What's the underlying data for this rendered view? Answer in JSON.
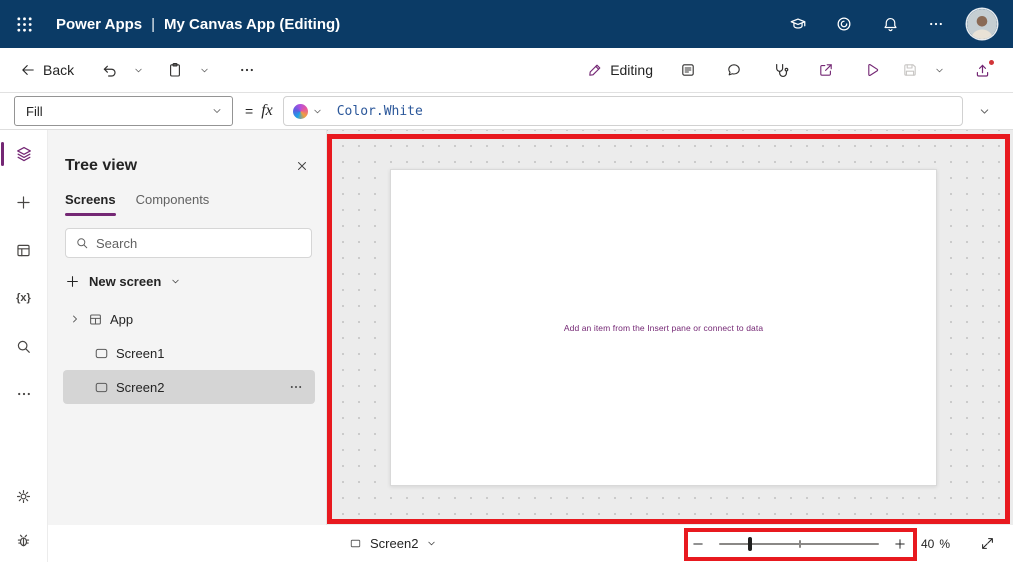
{
  "colors": {
    "header_bg": "#0b3b66",
    "accent_purple": "#742774",
    "annotation_red": "#e8191f",
    "formula_text_blue": "#2b579a",
    "canvas_hint_purple": "#742774"
  },
  "header": {
    "product": "Power Apps",
    "separator": "|",
    "app_title": "My Canvas App (Editing)",
    "icons": [
      "app-launcher-icon",
      "environment-icon",
      "copilot-icon",
      "notifications-icon",
      "more-icon",
      "avatar"
    ]
  },
  "command_bar": {
    "back_label": "Back",
    "editing_label": "Editing",
    "icons": [
      "back-icon",
      "undo-icon",
      "undo-chevron",
      "paste-icon",
      "paste-chevron",
      "more-icon",
      "pencil-icon",
      "app-checklist-icon",
      "comments-icon",
      "app-checker-icon",
      "share-icon",
      "preview-play-icon",
      "save-icon",
      "save-chevron",
      "publish-icon"
    ]
  },
  "formula_bar": {
    "property_selected": "Fill",
    "equals_sign": "=",
    "fx_label": "fx",
    "formula": "Color.White",
    "icons": [
      "chevron-down-icon",
      "copilot-icon",
      "expand-chevron-icon"
    ]
  },
  "left_rail": {
    "variables_glyph": "{x}",
    "icons": [
      "tree-view-icon",
      "insert-icon",
      "data-icon",
      "variables-icon",
      "search-icon",
      "more-icon",
      "settings-icon",
      "bug-icon"
    ]
  },
  "tree_view": {
    "title": "Tree view",
    "tabs": [
      {
        "label": "Screens",
        "active": true
      },
      {
        "label": "Components",
        "active": false
      }
    ],
    "search_placeholder": "Search",
    "new_screen_label": "New screen",
    "items": [
      {
        "label": "App",
        "type": "app",
        "expanded": false,
        "selected": false
      },
      {
        "label": "Screen1",
        "type": "screen",
        "selected": false
      },
      {
        "label": "Screen2",
        "type": "screen",
        "selected": true
      }
    ]
  },
  "canvas": {
    "empty_message": "Add an item from the Insert pane or connect to data"
  },
  "status_bar": {
    "screen_selector_label": "Screen2",
    "zoom_value": "40",
    "zoom_unit": "%",
    "icons": [
      "screen-icon",
      "chevron-down-icon",
      "zoom-out-icon",
      "zoom-slider",
      "zoom-in-icon",
      "fit-to-window-icon"
    ]
  },
  "annotations": {
    "color": "#e8191f",
    "highlights": [
      {
        "target": "canvas-region"
      },
      {
        "target": "zoom-slider-control"
      }
    ]
  }
}
